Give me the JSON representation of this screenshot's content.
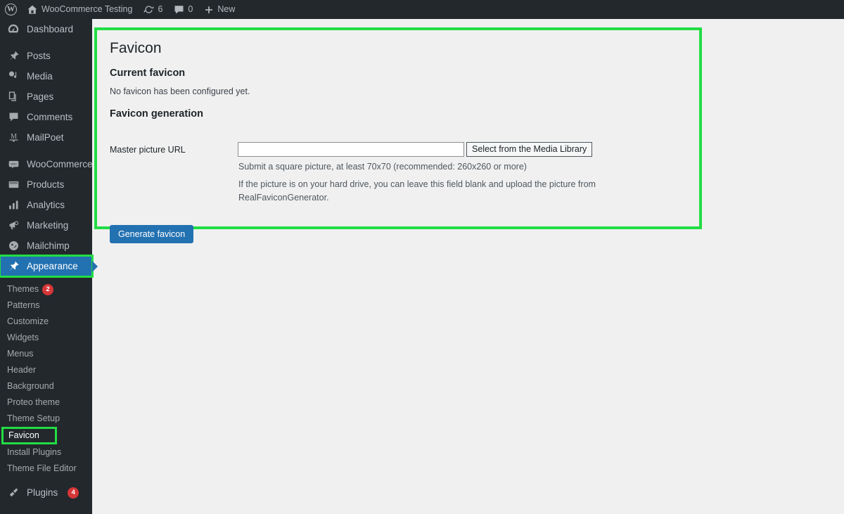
{
  "adminbar": {
    "wp_logo": "W",
    "site_name": "WooCommerce Testing",
    "updates_count": "6",
    "comments_count": "0",
    "new_label": "New"
  },
  "sidebar": {
    "items": [
      {
        "label": "Dashboard",
        "icon": "dashboard-icon",
        "current": false
      },
      {
        "label": "Posts",
        "icon": "pin-icon",
        "current": false,
        "gap_above": true
      },
      {
        "label": "Media",
        "icon": "media-icon",
        "current": false
      },
      {
        "label": "Pages",
        "icon": "pages-icon",
        "current": false
      },
      {
        "label": "Comments",
        "icon": "comment-icon",
        "current": false
      },
      {
        "label": "MailPoet",
        "icon": "mailpoet-icon",
        "current": false
      },
      {
        "label": "WooCommerce",
        "icon": "woocommerce-icon",
        "current": false,
        "gap_above": true
      },
      {
        "label": "Products",
        "icon": "products-icon",
        "current": false
      },
      {
        "label": "Analytics",
        "icon": "analytics-icon",
        "current": false
      },
      {
        "label": "Marketing",
        "icon": "marketing-icon",
        "current": false
      },
      {
        "label": "Mailchimp",
        "icon": "mailchimp-icon",
        "current": false
      },
      {
        "label": "Appearance",
        "icon": "appearance-icon",
        "current": true,
        "highlighted": true
      }
    ],
    "submenu": [
      {
        "label": "Themes",
        "badge": "2"
      },
      {
        "label": "Patterns"
      },
      {
        "label": "Customize"
      },
      {
        "label": "Widgets"
      },
      {
        "label": "Menus"
      },
      {
        "label": "Header"
      },
      {
        "label": "Background"
      },
      {
        "label": "Proteo theme"
      },
      {
        "label": "Theme Setup"
      },
      {
        "label": "Favicon",
        "highlighted": true
      },
      {
        "label": "Install Plugins"
      },
      {
        "label": "Theme File Editor"
      }
    ],
    "after_items": [
      {
        "label": "Plugins",
        "icon": "plugins-icon",
        "badge": "4"
      }
    ]
  },
  "main": {
    "page_title": "Favicon",
    "current_favicon_heading": "Current favicon",
    "current_favicon_text": "No favicon has been configured yet.",
    "favicon_generation_heading": "Favicon generation",
    "master_picture_label": "Master picture URL",
    "master_picture_value": "",
    "master_picture_placeholder": "",
    "media_library_button": "Select from the Media Library",
    "help_line_1": "Submit a square picture, at least 70x70 (recommended: 260x260 or more)",
    "help_line_2": "If the picture is on your hard drive, you can leave this field blank and upload the picture from RealFaviconGenerator.",
    "generate_button": "Generate favicon"
  },
  "colors": {
    "highlight_green": "#22dd44",
    "admin_blue": "#2271b1",
    "adminbar_bg": "#23282d",
    "badge_red": "#d63638",
    "page_bg": "#f0f0f1"
  }
}
